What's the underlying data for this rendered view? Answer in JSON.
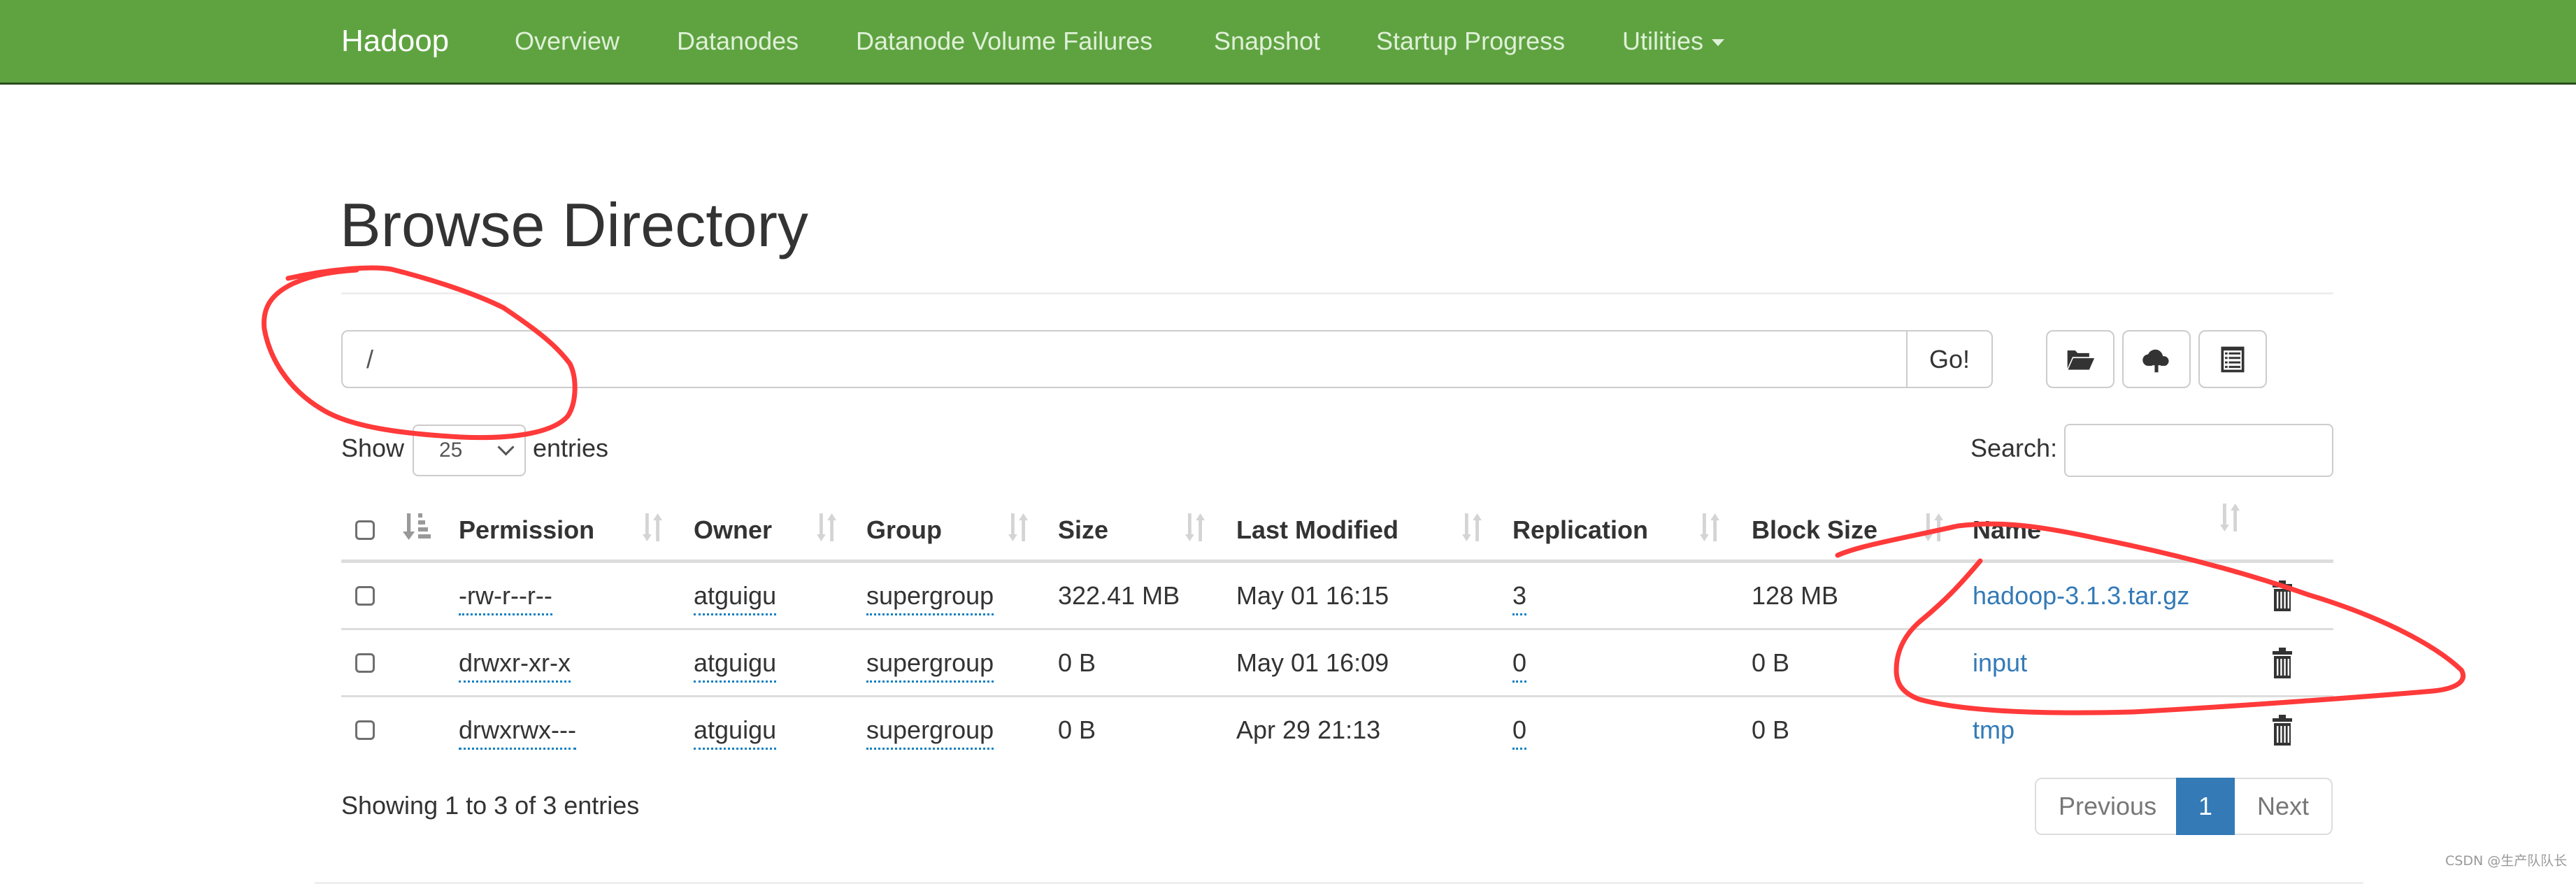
{
  "navbar": {
    "brand": "Hadoop",
    "links": [
      {
        "label": "Overview"
      },
      {
        "label": "Datanodes"
      },
      {
        "label": "Datanode Volume Failures"
      },
      {
        "label": "Snapshot"
      },
      {
        "label": "Startup Progress"
      },
      {
        "label": "Utilities",
        "dropdown": true
      }
    ],
    "color": "#5fa341"
  },
  "page": {
    "title": "Browse Directory"
  },
  "path_bar": {
    "value": "/",
    "go_label": "Go!",
    "actions": [
      {
        "name": "create-directory",
        "icon": "folder-open-icon"
      },
      {
        "name": "upload-file",
        "icon": "cloud-upload-icon"
      },
      {
        "name": "cut-paste",
        "icon": "list-alt-icon"
      }
    ]
  },
  "table_controls": {
    "show_label": "Show",
    "page_length": "25",
    "entries_label": "entries",
    "search_label": "Search:",
    "search_value": ""
  },
  "table": {
    "columns": [
      "Permission",
      "Owner",
      "Group",
      "Size",
      "Last Modified",
      "Replication",
      "Block Size",
      "Name"
    ],
    "rows": [
      {
        "permission": "-rw-r--r--",
        "owner": "atguigu",
        "group": "supergroup",
        "size": "322.41 MB",
        "last_modified": "May 01 16:15",
        "replication": "3",
        "block_size": "128 MB",
        "name": "hadoop-3.1.3.tar.gz"
      },
      {
        "permission": "drwxr-xr-x",
        "owner": "atguigu",
        "group": "supergroup",
        "size": "0 B",
        "last_modified": "May 01 16:09",
        "replication": "0",
        "block_size": "0 B",
        "name": "input"
      },
      {
        "permission": "drwxrwx---",
        "owner": "atguigu",
        "group": "supergroup",
        "size": "0 B",
        "last_modified": "Apr 29 21:13",
        "replication": "0",
        "block_size": "0 B",
        "name": "tmp"
      }
    ]
  },
  "footer": {
    "info": "Showing 1 to 3 of 3 entries",
    "pagination": {
      "previous": "Previous",
      "current": "1",
      "next": "Next"
    },
    "accent_color": "#337ab7"
  },
  "watermark": "CSDN @生产队队长",
  "annotations": {
    "color": "#ff3333"
  }
}
